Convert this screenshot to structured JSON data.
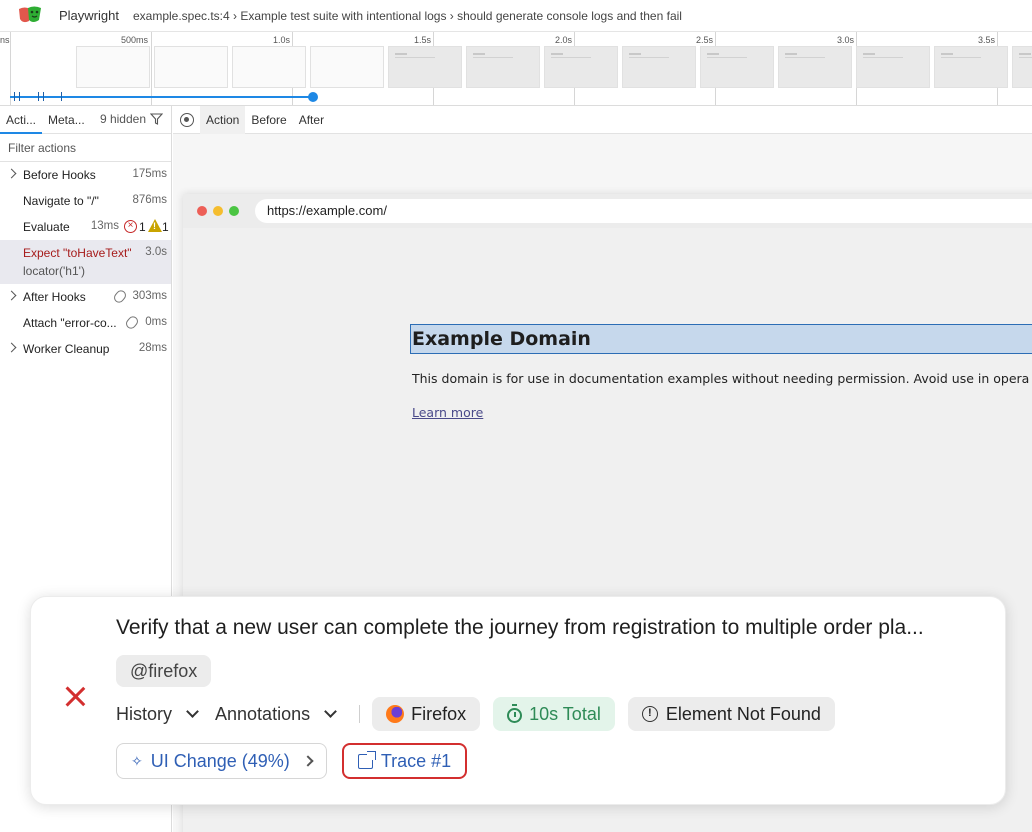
{
  "titlebar": {
    "app_name": "Playwright",
    "breadcrumb": "example.spec.ts:4 › Example test suite with intentional logs › should generate console logs and then fail"
  },
  "timeline": {
    "ticks": [
      "ns",
      "500ms",
      "1.0s",
      "1.5s",
      "2.0s",
      "2.5s",
      "3.0s",
      "3.5s"
    ]
  },
  "left_panel": {
    "tabs": [
      "Acti...",
      "Meta..."
    ],
    "hidden_label": "9 hidden",
    "filter_placeholder": "Filter actions",
    "actions": [
      {
        "name": "Before Hooks",
        "duration": "175ms"
      },
      {
        "name": "Navigate to \"/\"",
        "duration": "876ms"
      },
      {
        "name": "Evaluate",
        "duration": "13ms",
        "errors": "1",
        "warnings": "1"
      },
      {
        "name": "Expect \"toHaveText\"",
        "duration": "3.0s",
        "sub": "locator('h1')"
      },
      {
        "name": "After Hooks",
        "duration": "303ms"
      },
      {
        "name": "Attach \"error-co...",
        "duration": "0ms"
      },
      {
        "name": "Worker Cleanup",
        "duration": "28ms"
      }
    ]
  },
  "right_panel": {
    "tabs": [
      "Action",
      "Before",
      "After"
    ],
    "url": "https://example.com/",
    "page_heading": "Example Domain",
    "page_text": "This domain is for use in documentation examples without needing permission. Avoid use in opera",
    "page_link": "Learn more"
  },
  "card": {
    "title": "Verify that a new user can complete the journey from registration to multiple order pla...",
    "tag": "@firefox",
    "history_label": "History",
    "annotations_label": "Annotations",
    "browser_label": "Firefox",
    "total_label": "10s Total",
    "error_label": "Element Not Found",
    "ui_change_label": "UI Change (49%)",
    "trace_label": "Trace #1"
  },
  "colors": {
    "accent": "#1e88e5",
    "error": "#d32f2f",
    "link": "#2f5fb5",
    "success": "#2e8b57"
  }
}
